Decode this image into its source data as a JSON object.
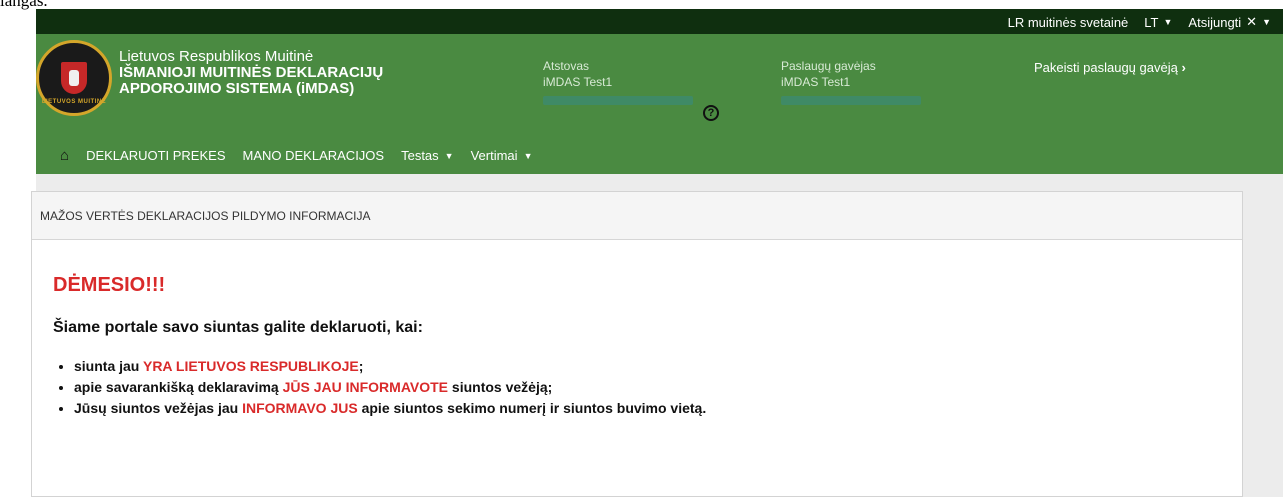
{
  "fragment_text": "langas.",
  "topbar": {
    "site_link": "LR muitinės svetainė",
    "lang": "LT",
    "logout": "Atsijungti"
  },
  "header": {
    "title_line1": "Lietuvos Respublikos Muitinė",
    "title_line2": "IŠMANIOJI MUITINĖS DEKLARACIJŲ",
    "title_line3": "APDOROJIMO SISTEMA (iMDAS)",
    "logo_ring_text": "LIETUVOS MUITINĖ",
    "representative_label": "Atstovas",
    "representative_value": "iMDAS Test1",
    "recipient_label": "Paslaugų gavėjas",
    "recipient_value": "iMDAS Test1",
    "change_recipient": "Pakeisti paslaugų gavėją"
  },
  "menu": {
    "declare": "DEKLARUOTI PREKES",
    "my_declarations": "MANO DEKLARACIJOS",
    "test": "Testas",
    "translations": "Vertimai"
  },
  "panel": {
    "header": "MAŽOS VERTĖS DEKLARACIJOS PILDYMO INFORMACIJA",
    "warning": "DĖMESIO!!!",
    "lead": "Šiame portale savo siuntas galite deklaruoti, kai:",
    "items": [
      {
        "before": "siunta jau ",
        "highlight": "YRA LIETUVOS RESPUBLIKOJE",
        "after": ";"
      },
      {
        "before": "apie savarankišką deklaravimą ",
        "highlight": "JŪS JAU INFORMAVOTE",
        "after": " siuntos vežėją;"
      },
      {
        "before": "Jūsų siuntos vežėjas jau ",
        "highlight": "INFORMAVO JUS",
        "after": " apie siuntos sekimo numerį ir siuntos buvimo vietą."
      }
    ]
  },
  "colors": {
    "topbar_bg": "#0f2f0f",
    "header_bg": "#4a8a41",
    "warning_red": "#d92a2a",
    "content_bg": "#ececec"
  },
  "icons": {
    "home": "home-icon",
    "help": "help-circle-icon",
    "caret": "caret-down-icon",
    "close": "close-icon",
    "chevron": "chevron-right-icon"
  }
}
